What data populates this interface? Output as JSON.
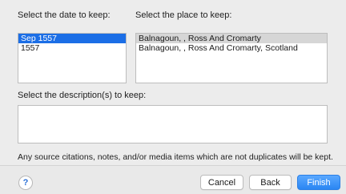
{
  "date_section": {
    "label": "Select the date to keep:",
    "options": [
      "Sep 1557",
      "1557"
    ]
  },
  "place_section": {
    "label": "Select the place to keep:",
    "options": [
      "Balnagoun, , Ross And Cromarty",
      "Balnagoun, , Ross And Cromarty, Scotland"
    ]
  },
  "description_section": {
    "label": "Select the description(s) to keep:"
  },
  "info_text": "Any source citations, notes, and/or media items which are not duplicates will be kept.",
  "footer": {
    "help_label": "?",
    "cancel_label": "Cancel",
    "back_label": "Back",
    "finish_label": "Finish"
  },
  "colors": {
    "selection_active": "#1b6ee6",
    "selection_inactive": "#d6d6d6",
    "primary_button": "#2a86f3"
  }
}
